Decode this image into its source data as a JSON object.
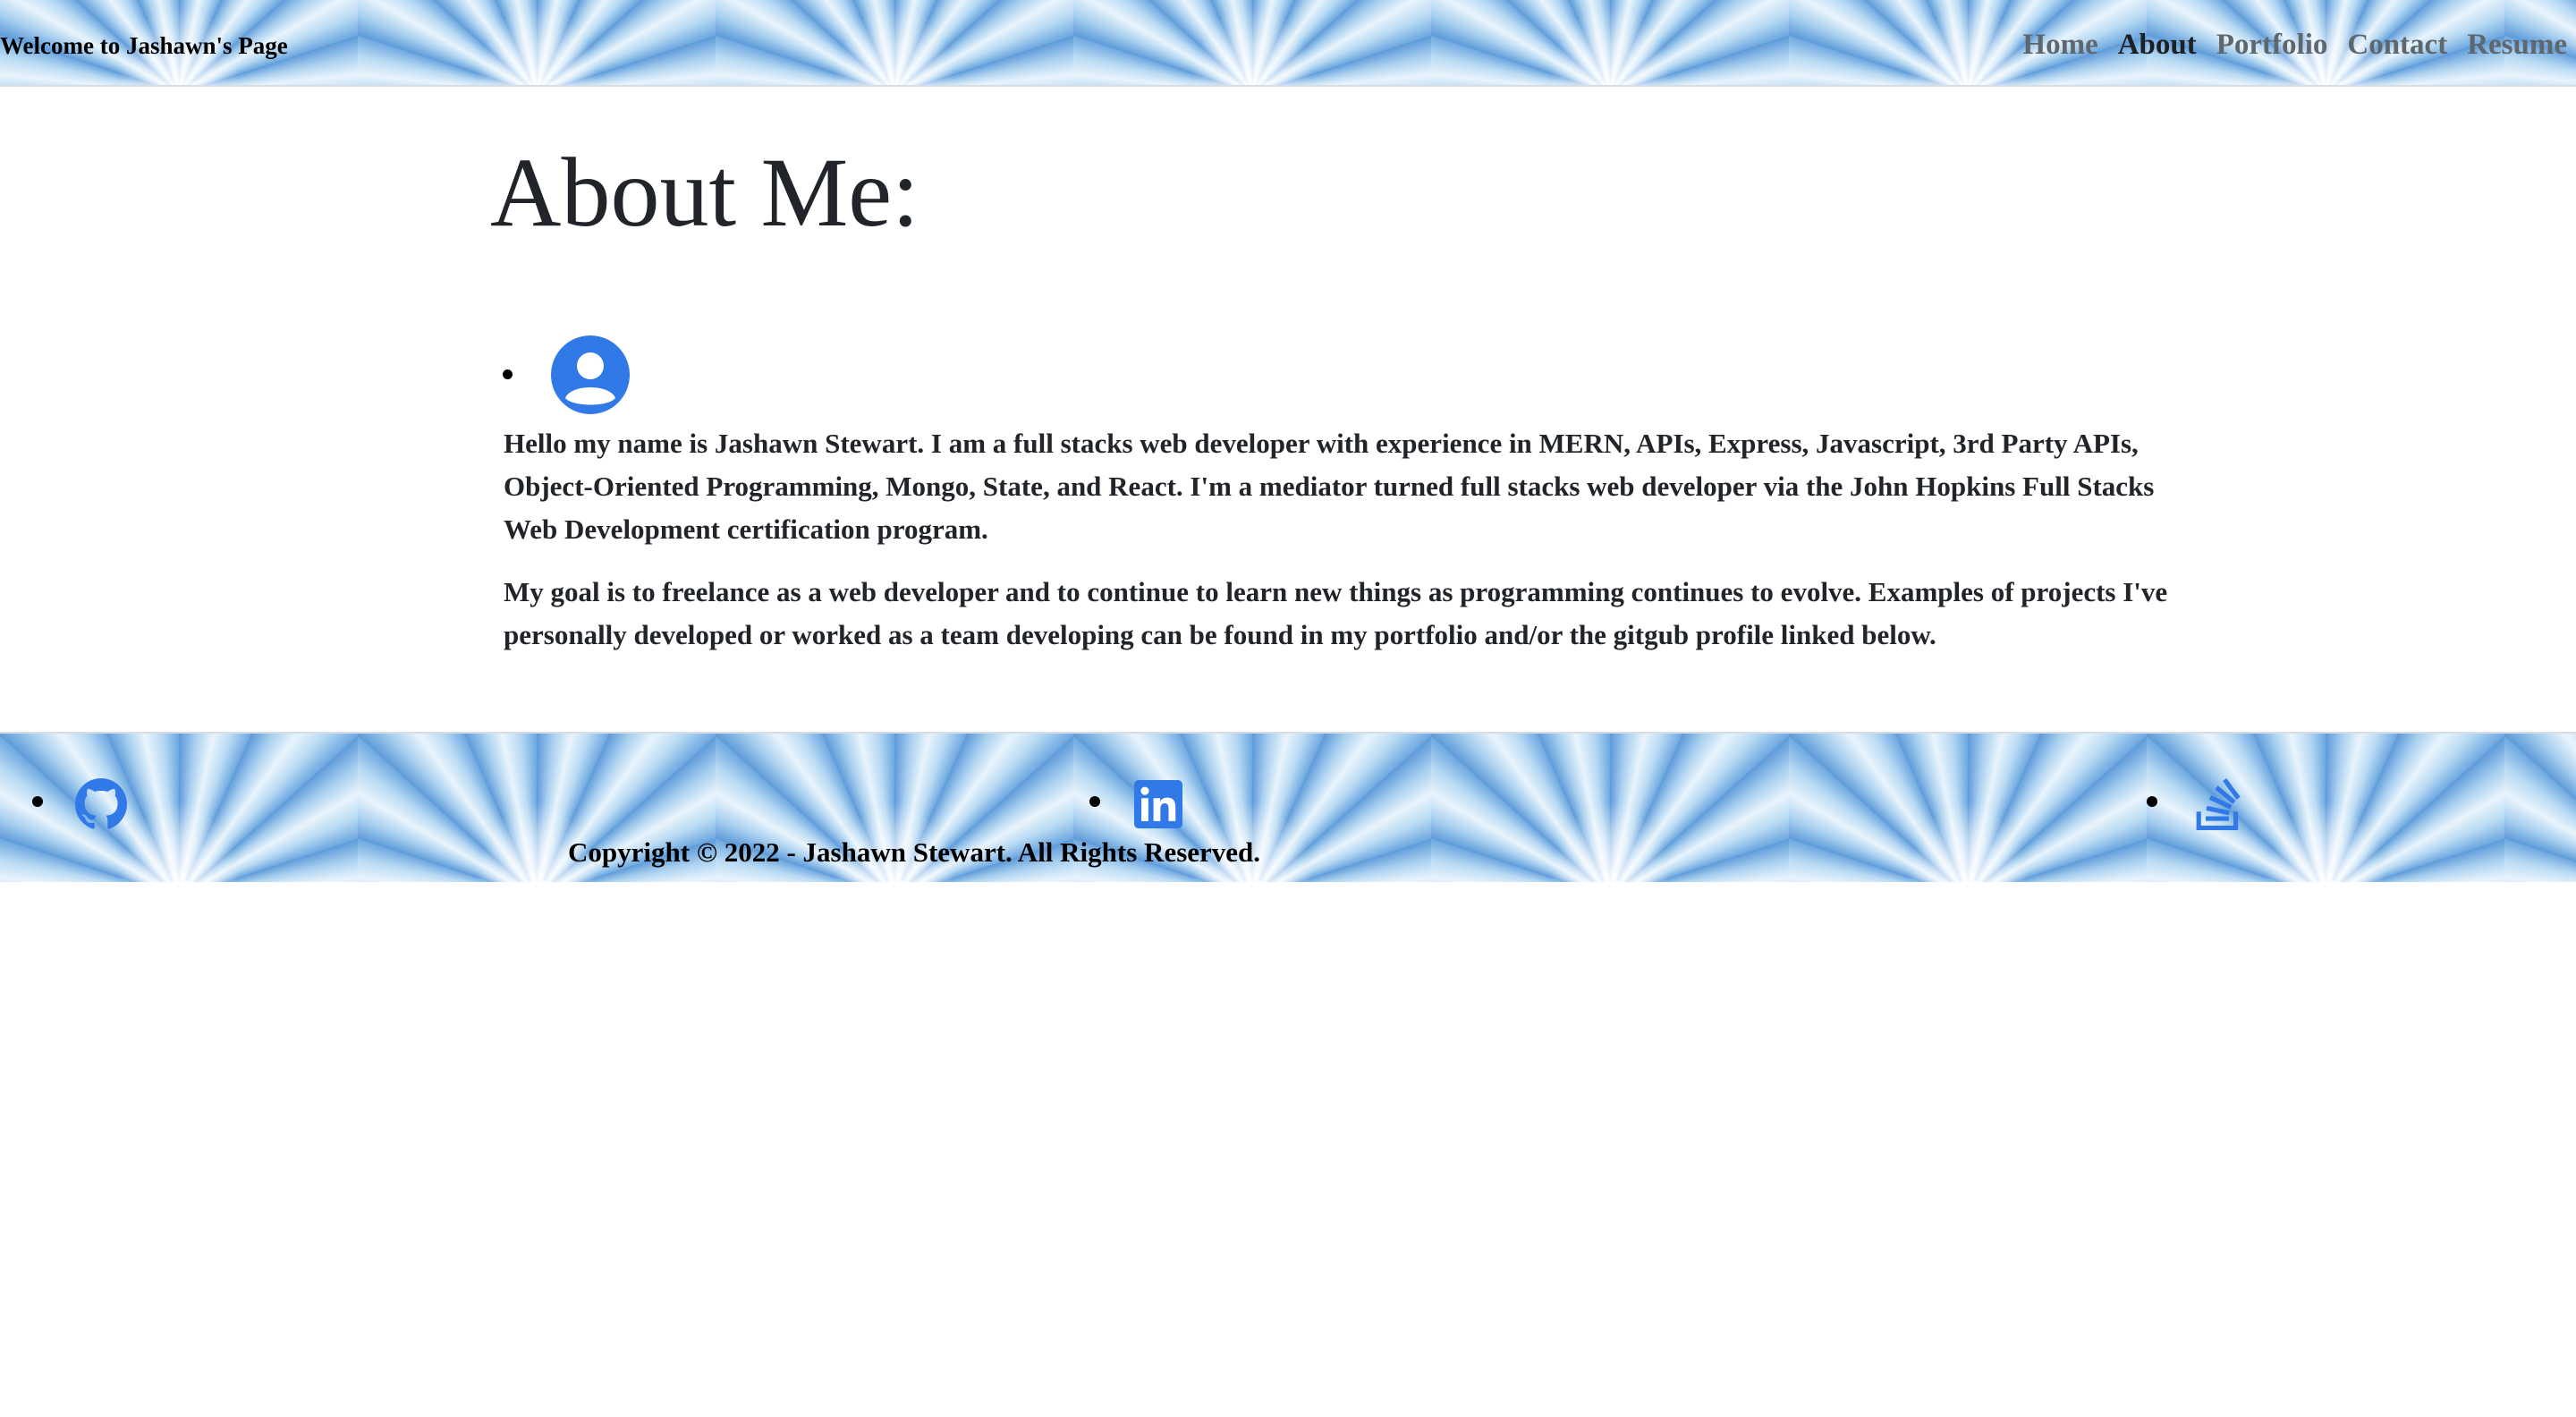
{
  "header": {
    "brand": "Welcome to Jashawn's Page",
    "nav": [
      {
        "label": "Home",
        "active": false
      },
      {
        "label": "About",
        "active": true
      },
      {
        "label": "Portfolio",
        "active": false
      },
      {
        "label": "Contact",
        "active": false
      },
      {
        "label": "Resume",
        "active": false
      }
    ]
  },
  "main": {
    "title": "About Me:",
    "avatar_icon": "user-circle-icon",
    "paragraphs": [
      "Hello my name is Jashawn Stewart. I am a full stacks web developer with experience in MERN, APIs, Express, Javascript, 3rd Party APIs, Object-Oriented Programming, Mongo, State, and React. I'm a mediator turned full stacks web developer via the John Hopkins Full Stacks Web Development certification program.",
      "My goal is to freelance as a web developer and to continue to learn new things as programming continues to evolve. Examples of projects I've personally developed or worked as a team developing can be found in my portfolio and/or the gitgub profile linked below."
    ]
  },
  "footer": {
    "social": [
      {
        "icon": "github-icon"
      },
      {
        "icon": "linkedin-icon"
      },
      {
        "icon": "stack-overflow-icon"
      }
    ],
    "copyright": "Copyright © 2022 - Jashawn Stewart. All Rights Reserved."
  },
  "colors": {
    "icon_blue": "#3279e8",
    "text_dark": "#212529",
    "nav_muted": "#5f666c"
  }
}
